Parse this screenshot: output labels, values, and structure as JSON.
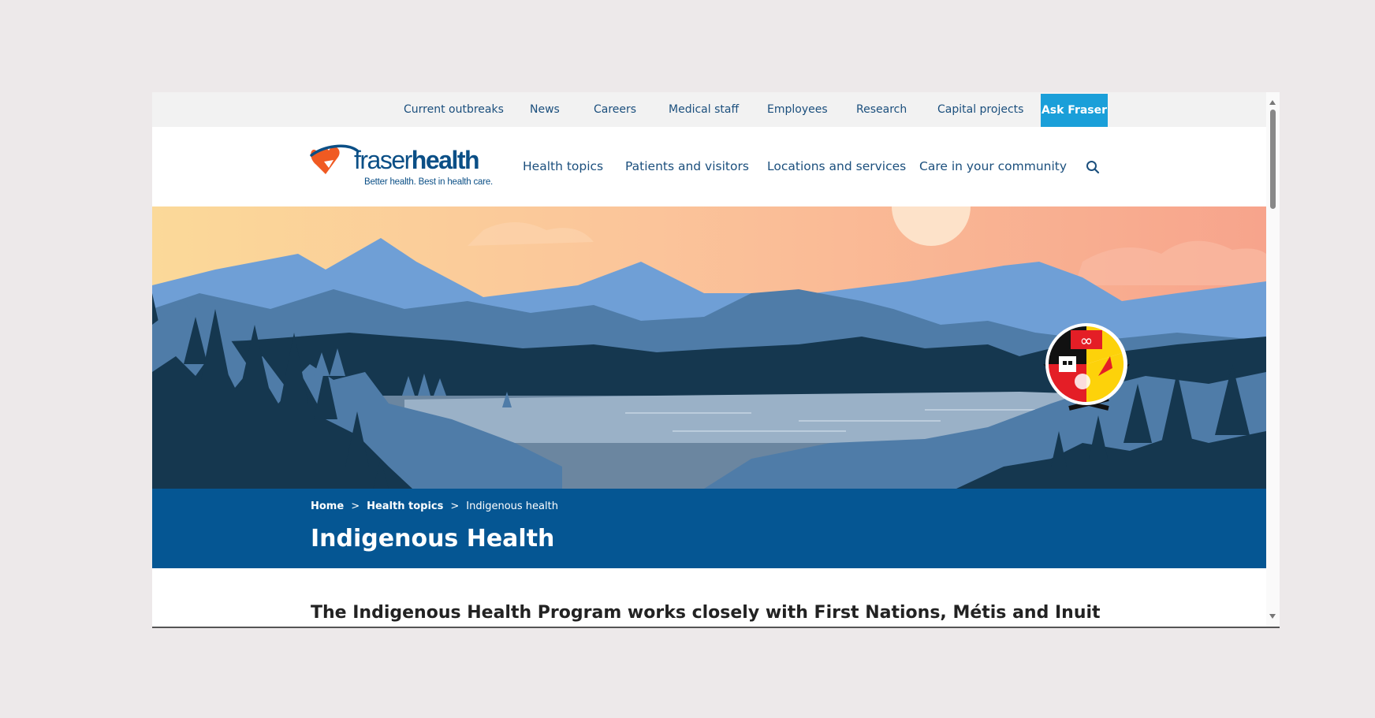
{
  "utility_nav": {
    "items": [
      "Current outbreaks",
      "News",
      "Careers",
      "Medical staff",
      "Employees",
      "Research",
      "Capital projects"
    ],
    "ask_label": "Ask Fraser"
  },
  "logo": {
    "word_light": "fraser",
    "word_bold": "health",
    "tagline": "Better health. Best in health care."
  },
  "main_nav": {
    "items": [
      "Health topics",
      "Patients and visitors",
      "Locations and services",
      "Care in your community"
    ]
  },
  "icons": {
    "search": "search-icon",
    "logo_mark": "heart-swoosh-icon",
    "emblem": "metis-inuit-first-nations-emblem"
  },
  "breadcrumb": {
    "home": "Home",
    "parent": "Health topics",
    "current": "Indigenous health",
    "separator": ">"
  },
  "page": {
    "title": "Indigenous Health",
    "intro": "The Indigenous Health Program works closely with First Nations, Métis and Inuit"
  },
  "colors": {
    "brand_blue": "#055693",
    "accent_cyan": "#1a9fd9",
    "logo_orange": "#f05a22",
    "nav_text": "#1b4f7d"
  }
}
